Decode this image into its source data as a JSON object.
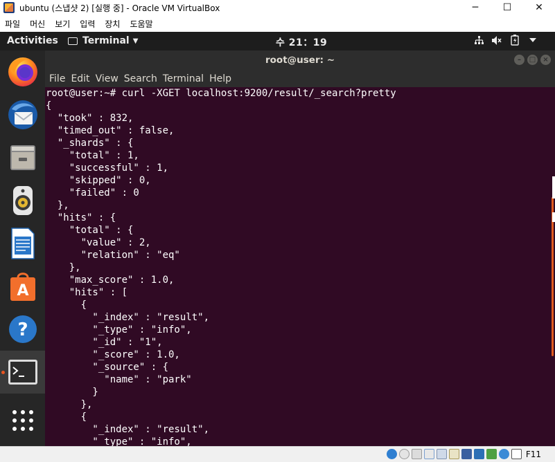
{
  "vbox": {
    "title": "ubuntu (스냅샷 2) [실행 중] - Oracle VM VirtualBox",
    "window_buttons": {
      "minimize": "─",
      "maximize": "☐",
      "close": "✕"
    },
    "menu": [
      "파일",
      "머신",
      "보기",
      "입력",
      "장치",
      "도움말"
    ],
    "host_key": "F11"
  },
  "gnome": {
    "activities": "Activities",
    "app_menu": "Terminal",
    "clock": "수 21：19"
  },
  "dock": {
    "items": [
      "firefox-icon",
      "thunderbird-icon",
      "files-icon",
      "rhythmbox-icon",
      "writer-icon",
      "software-icon",
      "help-icon",
      "terminal-icon",
      "show-apps-icon"
    ]
  },
  "terminal": {
    "title": "root@user: ~",
    "menu": [
      "File",
      "Edit",
      "View",
      "Search",
      "Terminal",
      "Help"
    ],
    "lines": [
      "root@user:~# curl -XGET localhost:9200/result/_search?pretty",
      "{",
      "  \"took\" : 832,",
      "  \"timed_out\" : false,",
      "  \"_shards\" : {",
      "    \"total\" : 1,",
      "    \"successful\" : 1,",
      "    \"skipped\" : 0,",
      "    \"failed\" : 0",
      "  },",
      "  \"hits\" : {",
      "    \"total\" : {",
      "      \"value\" : 2,",
      "      \"relation\" : \"eq\"",
      "    },",
      "    \"max_score\" : 1.0,",
      "    \"hits\" : [",
      "      {",
      "        \"_index\" : \"result\",",
      "        \"_type\" : \"info\",",
      "        \"_id\" : \"1\",",
      "        \"_score\" : 1.0,",
      "        \"_source\" : {",
      "          \"name\" : \"park\"",
      "        }",
      "      },",
      "      {",
      "        \"_index\" : \"result\",",
      "        \"_type\" : \"info\","
    ]
  },
  "colors": {
    "terminal_bg": "#300a24",
    "topbar_bg": "#1d1d1d",
    "dock_bg": "#262626",
    "accent": "#e95420"
  }
}
